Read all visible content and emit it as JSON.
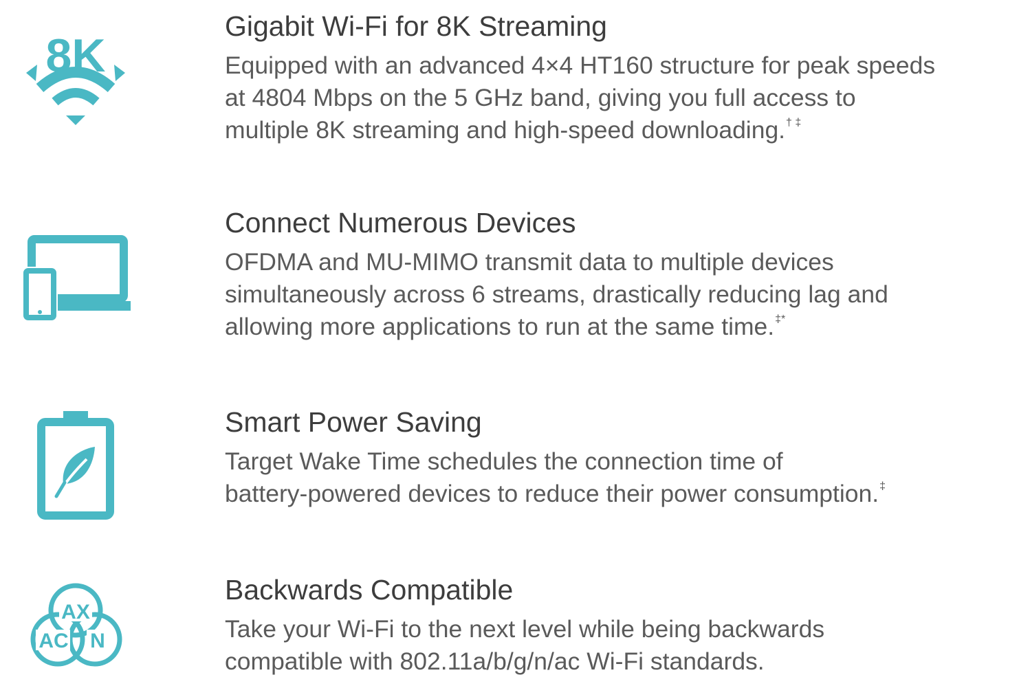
{
  "brand_color": "#4ab8c4",
  "features": [
    {
      "icon": "8k-wifi-icon",
      "icon_text": "8K",
      "title": "Gigabit Wi-Fi for 8K Streaming",
      "lines": [
        "Equipped with an advanced 4×4 HT160 structure for peak speeds",
        "at 4804 Mbps on the 5 GHz band, giving you full access to",
        "multiple 8K streaming and high-speed downloading."
      ],
      "footnote": "† ‡"
    },
    {
      "icon": "devices-icon",
      "title": "Connect Numerous Devices",
      "lines": [
        "OFDMA and MU-MIMO transmit data to multiple devices",
        "simultaneously across 6 streams, drastically reducing lag and",
        "allowing more applications to run at the same time."
      ],
      "footnote": "‡*"
    },
    {
      "icon": "battery-leaf-icon",
      "title": "Smart Power Saving",
      "lines": [
        "Target Wake Time schedules the connection time of",
        "battery-powered devices to reduce their power consumption."
      ],
      "footnote": "‡"
    },
    {
      "icon": "ax-ac-n-icon",
      "icon_labels": [
        "AX",
        "AC",
        "N"
      ],
      "title": "Backwards Compatible",
      "lines": [
        "Take your Wi-Fi to the next level while being backwards",
        "compatible with 802.11a/b/g/n/ac Wi-Fi standards."
      ],
      "footnote": ""
    }
  ]
}
